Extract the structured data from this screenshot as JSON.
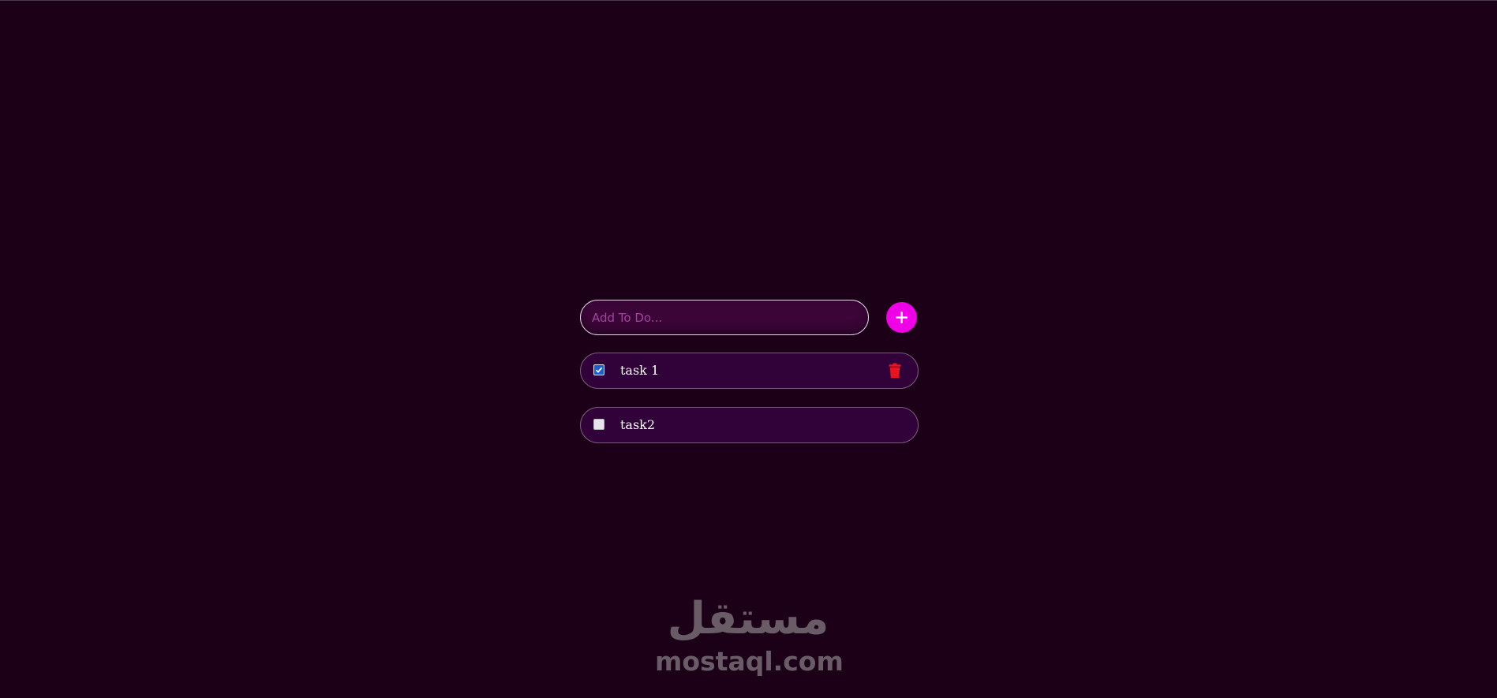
{
  "input": {
    "placeholder": "Add To Do...",
    "value": ""
  },
  "add_button": {
    "icon": "plus-icon"
  },
  "tasks": [
    {
      "label": "task 1",
      "checked": true,
      "delete_icon": "trash-icon"
    },
    {
      "label": "task2",
      "checked": false
    }
  ],
  "watermark": {
    "arabic": "مستقل",
    "latin": "mostaql.com"
  },
  "colors": {
    "background": "#1c0018",
    "accent": "#f000e6",
    "delete": "#e8151f",
    "checkbox_checked": "#1a5fd6"
  }
}
